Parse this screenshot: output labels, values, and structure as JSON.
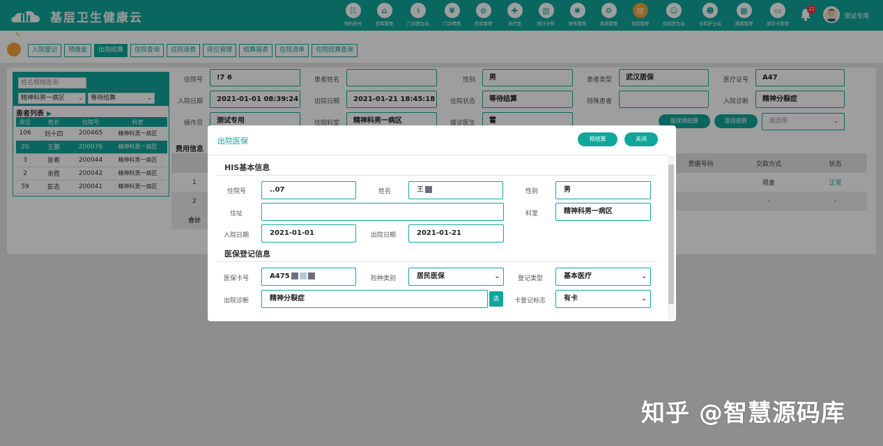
{
  "app": {
    "title": "基层卫生健康云",
    "user": "测试专用",
    "notifications": "11"
  },
  "nav": [
    {
      "label": "预约挂号",
      "icon": "calendar-icon",
      "glyph": "☷"
    },
    {
      "label": "药库管理",
      "icon": "warehouse-icon",
      "glyph": "⌂"
    },
    {
      "label": "门诊医生站",
      "icon": "doctor-icon",
      "glyph": "⚕"
    },
    {
      "label": "门诊费用",
      "icon": "coin-icon",
      "glyph": "¥"
    },
    {
      "label": "药房管理",
      "icon": "pill-icon",
      "glyph": "⊘"
    },
    {
      "label": "治疗室",
      "icon": "therapy-icon",
      "glyph": "✚"
    },
    {
      "label": "统计分析",
      "icon": "chart-icon",
      "glyph": "▥"
    },
    {
      "label": "财务管理",
      "icon": "finance-icon",
      "glyph": "✱"
    },
    {
      "label": "系统管理",
      "icon": "settings-icon",
      "glyph": "⚙"
    },
    {
      "label": "住院管理",
      "icon": "bed-icon",
      "glyph": "▤"
    },
    {
      "label": "住院医生站",
      "icon": "inpatient-doctor-icon",
      "glyph": "☺"
    },
    {
      "label": "住院护士站",
      "icon": "nurse-icon",
      "glyph": "☻"
    },
    {
      "label": "病案管理",
      "icon": "records-icon",
      "glyph": "▦"
    },
    {
      "label": "就诊卡管理",
      "icon": "card-icon",
      "glyph": "▭"
    }
  ],
  "module_tabs": [
    "入院登记",
    "预缴金",
    "出院结算",
    "住院查询",
    "住院退费",
    "床位管理",
    "结算报表",
    "住院清单",
    "住院结算查询"
  ],
  "patient_panel": {
    "search_placeholder": "姓名模糊查询",
    "ward": "精神科男一病区",
    "status": "等待结算",
    "title": "患者列表",
    "columns": [
      "床位",
      "姓名",
      "住院号",
      "科室"
    ],
    "rows": [
      {
        "bed": "106",
        "name": "刘十四",
        "no": "200465",
        "dept": "精神科男一病区"
      },
      {
        "bed": "20",
        "name": "王鹏",
        "no": "200076",
        "dept": "精神科男一病区"
      },
      {
        "bed": "3",
        "name": "张希",
        "no": "200044",
        "dept": "精神科男一病区"
      },
      {
        "bed": "2",
        "name": "余胜",
        "no": "200042",
        "dept": "精神科男一病区"
      },
      {
        "bed": "59",
        "name": "彭志",
        "no": "200041",
        "dept": "精神科男一病区"
      }
    ]
  },
  "patient_info": {
    "admission_no_label": "住院号",
    "admission_no": "!7 6",
    "name_label": "患者姓名",
    "name": "",
    "gender_label": "性别",
    "gender": "男",
    "type_label": "患者类型",
    "type": "武汉居保",
    "insurance_label": "医疗证号",
    "insurance": "A47",
    "in_date_label": "入院日期",
    "in_date": "2021-01-01 08:39:24",
    "out_date_label": "出院日期",
    "out_date": "2021-01-21 18:45:18",
    "state_label": "住院状态",
    "state": "等待结算",
    "special_label": "特殊患者",
    "special": "",
    "diagnosis_label": "入院诊断",
    "diagnosis": "精神分裂症",
    "operator_label": "操作员",
    "operator": "测试专用",
    "dept_label": "住院科室",
    "dept": "精神科男一病区",
    "doctor_label": "接诊医生",
    "doctor": "霍",
    "pre_settle": "医保预结算",
    "settle": "医保结算",
    "select_placeholder": "请选择"
  },
  "fees": {
    "title": "费用信息",
    "columns": [
      "",
      "票据号码",
      "交款方式",
      "状态"
    ],
    "rows": [
      {
        "idx": "1",
        "method": "现金",
        "state": "正常"
      },
      {
        "idx": "2",
        "method": "-",
        "state": "-"
      }
    ],
    "total_label": "合计"
  },
  "modal": {
    "title": "出院医保",
    "btn_pre": "预结算",
    "btn_close": "关闭",
    "his_title": "HIS基本信息",
    "reg_title": "医保登记信息",
    "fields": {
      "admission_no_label": "住院号",
      "admission_no": "..07",
      "name_label": "姓名",
      "name": "王",
      "gender_label": "性别",
      "gender": "男",
      "address_label": "住址",
      "address": "",
      "dept_label": "科室",
      "dept": "精神科男一病区",
      "in_date_label": "入院日期",
      "in_date": "2021-01-01",
      "out_date_label": "出院日期",
      "out_date": "2021-01-21",
      "card_label": "医保卡号",
      "card": "A475",
      "insure_type_label": "险种类别",
      "insure_type": "居民医保",
      "reg_type_label": "登记类型",
      "reg_type": "基本医疗",
      "out_diag_label": "出院诊断",
      "out_diag": "精神分裂症",
      "pick": "选",
      "card_flag_label": "卡登记标志",
      "card_flag": "有卡"
    }
  },
  "watermark": "知乎 @智慧源码库"
}
